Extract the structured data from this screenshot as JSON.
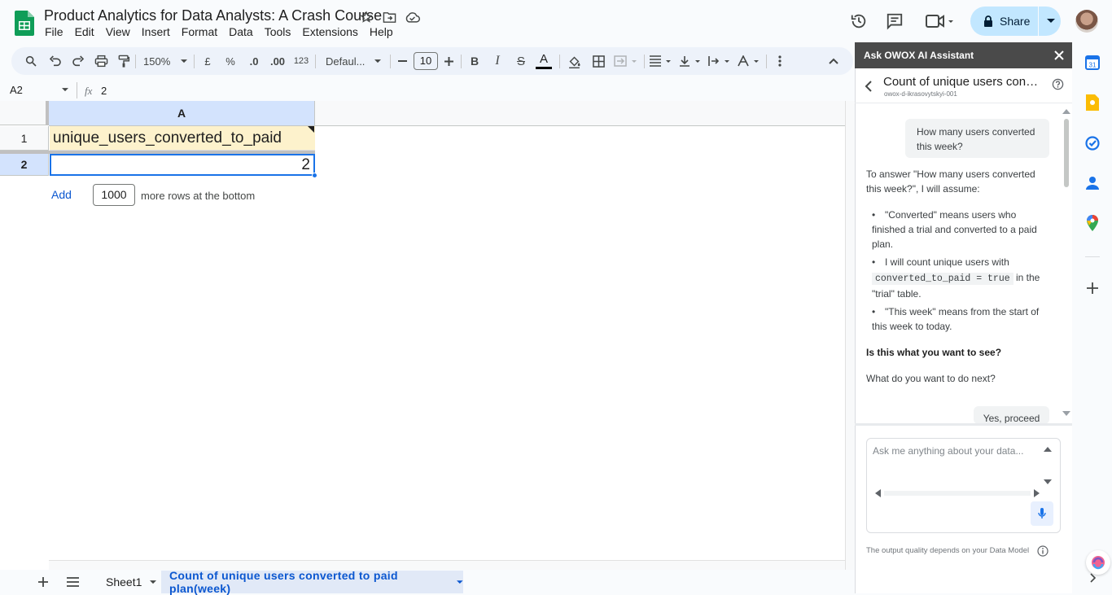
{
  "app": {
    "doc_title": "Product Analytics for Data Analysts: A Crash Course",
    "menu": [
      "File",
      "Edit",
      "View",
      "Insert",
      "Format",
      "Data",
      "Tools",
      "Extensions",
      "Help"
    ],
    "share_label": "Share"
  },
  "toolbar": {
    "zoom": "150%",
    "currency": "£",
    "percent": "%",
    "dec_decrease": ".0",
    "dec_increase": ".00",
    "number_format": "123",
    "font": "Defaul...",
    "font_size": "10"
  },
  "formula_bar": {
    "cell_ref": "A2",
    "value": "2"
  },
  "grid": {
    "column_header": "A",
    "row_headers": [
      "1",
      "2"
    ],
    "cells": {
      "a1": "unique_users_converted_to_paid",
      "a2": "2"
    },
    "add_label": "Add",
    "add_rows_value": "1000",
    "more_rows_text": "more rows at the bottom"
  },
  "sheet_tabs": {
    "tabs": [
      "Sheet1",
      "Count of unique users converted to paid plan(week)"
    ],
    "active_index": 1
  },
  "side_panel": {
    "header": "Ask OWOX AI Assistant",
    "chat_title": "Count of unique users converted to paid",
    "chat_subtitle": "owox-d-ikrasovytskyi-001",
    "user_question": "How many users converted this week?",
    "reply_intro": "To answer \"How many users converted this week?\", I will assume:",
    "assumptions": [
      "\"Converted\" means users who finished a trial and converted to a paid plan.",
      "I will count unique users with",
      "\"This week\" means from the start of this week to today."
    ],
    "code_snippet": "converted_to_paid = true",
    "after_code": " in the \"trial\" table.",
    "confirm_question": "Is this what you want to see?",
    "next_prompt": "What do you want to do next?",
    "yes_button": "Yes, proceed",
    "input_placeholder": "Ask me anything about your data...",
    "quality_note": "The output quality depends on your Data Model"
  },
  "colors": {
    "accent": "#0b57d0",
    "selection": "#1a73e8",
    "header_cell_fill": "#fdf2cc",
    "panel_header": "#4a4a4a",
    "share_button": "#c2e7ff"
  },
  "icons": [
    "sheets-logo",
    "star-icon",
    "move-folder-icon",
    "cloud-status-icon",
    "history-icon",
    "comment-icon",
    "meet-icon",
    "lock-icon",
    "search-icon",
    "undo-icon",
    "redo-icon",
    "print-icon",
    "paint-format-icon",
    "bold-icon",
    "italic-icon",
    "strikethrough-icon",
    "text-color-icon",
    "fill-color-icon",
    "borders-icon",
    "merge-icon",
    "align-icon",
    "valign-icon",
    "wrap-icon",
    "rotate-icon",
    "more-icon",
    "collapse-icon",
    "close-icon",
    "back-icon",
    "help-icon",
    "mic-icon",
    "info-icon",
    "calendar-icon",
    "keep-icon",
    "tasks-icon",
    "contacts-icon",
    "maps-icon",
    "add-icon"
  ]
}
